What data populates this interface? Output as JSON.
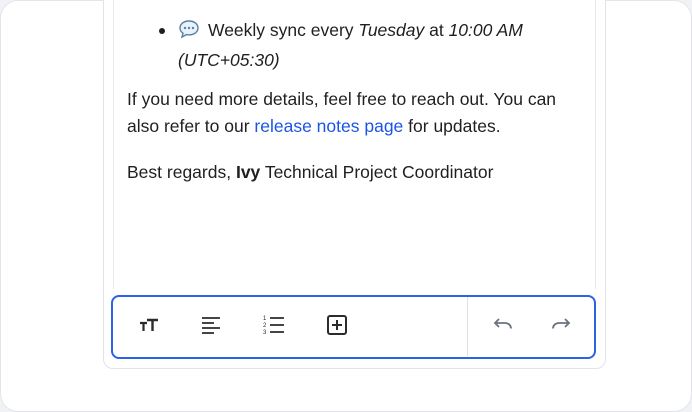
{
  "message": {
    "bullet": {
      "icon": "speech-bubble-icon",
      "prefix": "Weekly sync every ",
      "day": "Tuesday",
      "mid": " at ",
      "time": "10:00 AM",
      "timezone": "(UTC+05:30)"
    },
    "paragraph": {
      "text_before": "If you need more details, feel free to reach out. You can also refer to our ",
      "link_text": "release notes page",
      "text_after": " for updates."
    },
    "signoff": {
      "greeting": "Best regards, ",
      "name": "Ivy",
      "title": " Technical Project Coordinator"
    }
  },
  "toolbar": {
    "items": [
      {
        "name": "text-size-icon"
      },
      {
        "name": "align-left-icon"
      },
      {
        "name": "numbered-list-icon"
      },
      {
        "name": "insert-box-icon"
      },
      {
        "name": "undo-icon"
      },
      {
        "name": "redo-icon"
      }
    ],
    "accent_color": "#2a62e8"
  }
}
